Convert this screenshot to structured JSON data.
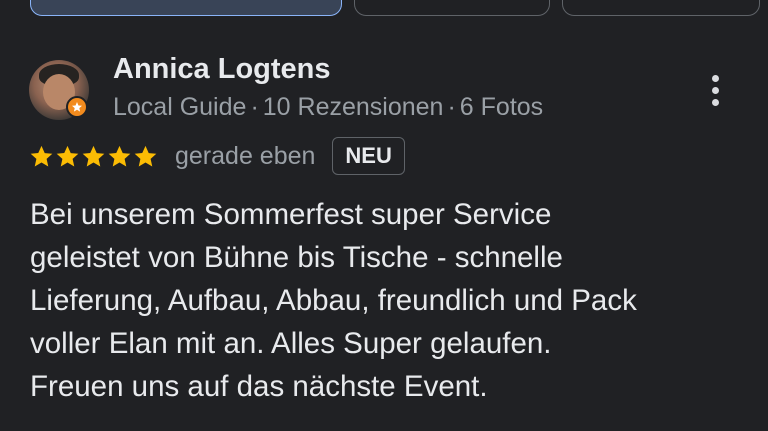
{
  "review": {
    "author": {
      "name": "Annica Logtens",
      "role": "Local Guide",
      "reviews_count": "10 Rezensionen",
      "photos_count": "6 Fotos",
      "separator": "·",
      "avatar_icon": "user-photo",
      "badge_icon": "local-guide-star-icon"
    },
    "rating": {
      "stars": 5,
      "max_stars": 5,
      "star_color": "#fbbc04",
      "time": "gerade eben",
      "badge": "NEU"
    },
    "text_lines": [
      "Bei unserem Sommerfest super Service",
      "geleistet von Bühne bis Tische - schnelle",
      "Lieferung, Aufbau, Abbau, freundlich und Pack",
      "voller Elan mit an. Alles Super gelaufen.",
      "Freuen uns auf das nächste Event."
    ],
    "more_icon": "more-vert-icon"
  },
  "colors": {
    "background": "#202124",
    "text_primary": "#e8eaed",
    "text_secondary": "#9aa0a6",
    "accent_chip": "#8ab4f8",
    "local_guide_badge": "#f28b1e"
  }
}
